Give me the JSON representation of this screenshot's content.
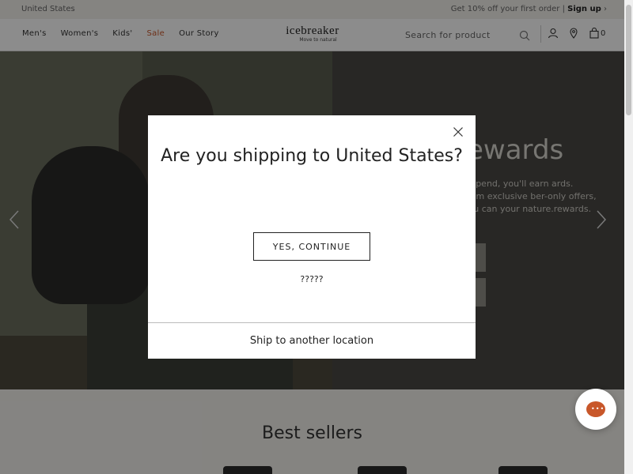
{
  "topbar": {
    "region": "United States",
    "promo_text": "Get 10% off your first order |",
    "signup_label": "Sign up"
  },
  "nav": {
    "links": [
      "Men's",
      "Women's",
      "Kids'",
      "Sale",
      "Our Story"
    ],
    "logo_word": "icebreaker",
    "logo_tagline": "Move to natural",
    "search_placeholder": "Search for product",
    "cart_count": "0",
    "accent": "#c8572a"
  },
  "hero": {
    "title": "ewards",
    "copy": "u spend, you'll earn ards. From exclusive ber-only offers, you can your nature.rewards."
  },
  "best_sellers": {
    "title": "Best sellers"
  },
  "modal": {
    "question": "Are you shipping to United States?",
    "yes_button": "YES, CONTINUE",
    "alternate_language": "?????",
    "ship_other": "Ship to another location"
  }
}
